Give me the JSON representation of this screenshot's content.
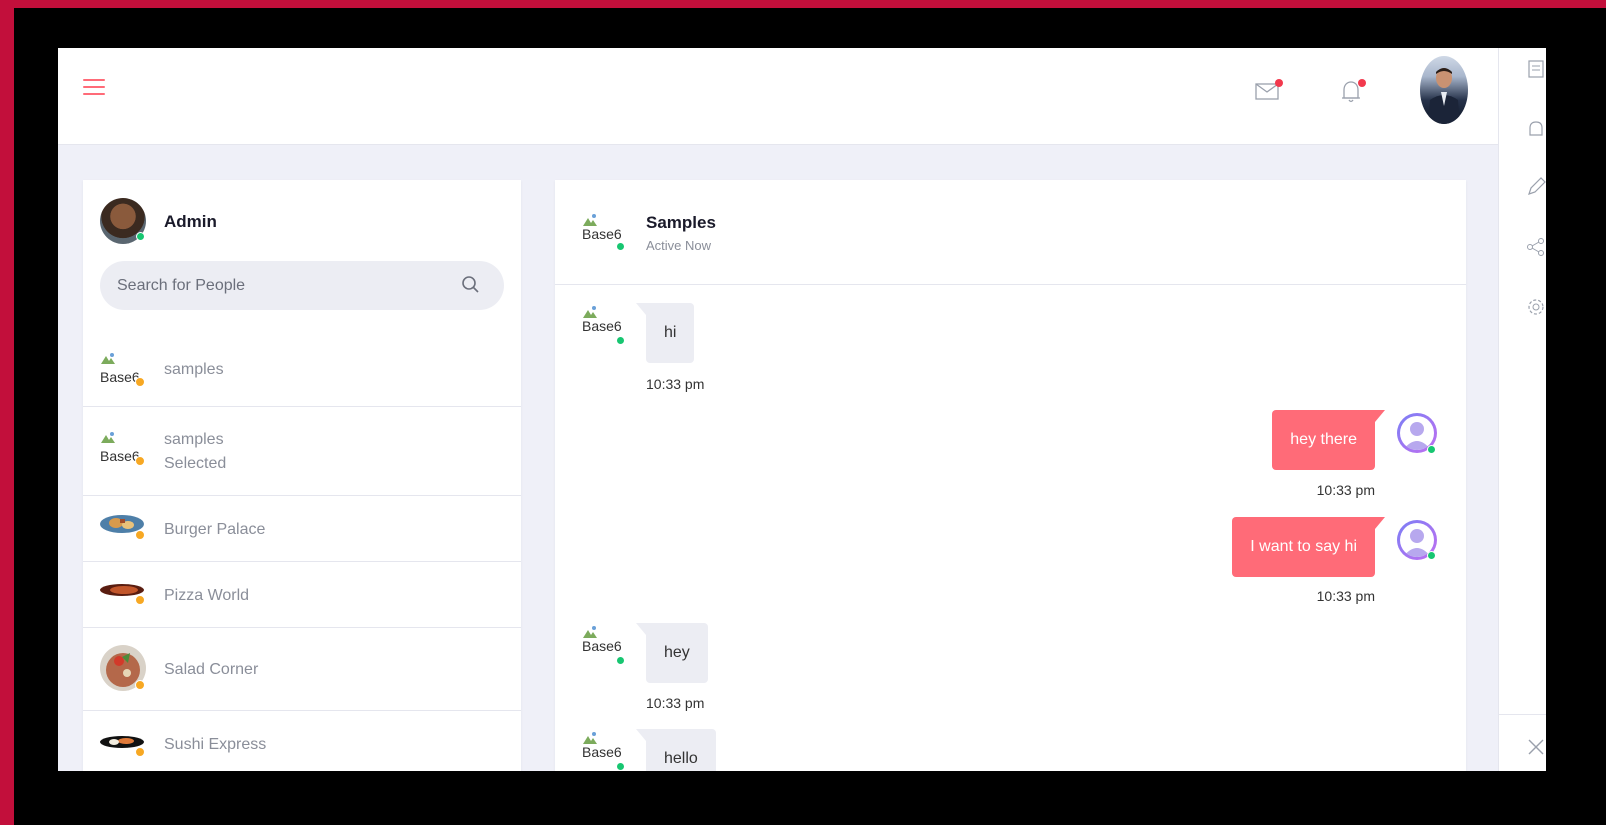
{
  "header": {
    "menu_icon": "hamburger-menu-icon",
    "mail_icon": "mail-icon",
    "bell_icon": "bell-icon"
  },
  "left": {
    "admin_name": "Admin",
    "search_placeholder": "Search for People",
    "contacts": [
      {
        "name": "samples",
        "sub": "",
        "img_alt": "Base6",
        "status": "away"
      },
      {
        "name": "samples",
        "sub": "Selected",
        "img_alt": "Base6",
        "status": "away"
      },
      {
        "name": "Burger Palace",
        "sub": "",
        "img_alt": "",
        "status": "away"
      },
      {
        "name": "Pizza World",
        "sub": "",
        "img_alt": "",
        "status": "away"
      },
      {
        "name": "Salad Corner",
        "sub": "",
        "img_alt": "",
        "status": "away"
      },
      {
        "name": "Sushi Express",
        "sub": "",
        "img_alt": "",
        "status": "away"
      }
    ]
  },
  "chat": {
    "title": "Samples",
    "status": "Active Now",
    "img_alt": "Base6",
    "messages": [
      {
        "dir": "in",
        "text": "hi",
        "time": "10:33 pm",
        "img_alt": "Base6"
      },
      {
        "dir": "out",
        "text": "hey there",
        "time": "10:33 pm"
      },
      {
        "dir": "out",
        "text": "I want to say hi",
        "time": "10:33 pm"
      },
      {
        "dir": "in",
        "text": "hey",
        "time": "10:33 pm",
        "img_alt": "Base6"
      },
      {
        "dir": "in",
        "text": "hello",
        "time": "",
        "img_alt": "Base6"
      }
    ]
  },
  "colors": {
    "accent": "#ff6b78",
    "online": "#17c671",
    "away": "#f7a823",
    "frame": "#c20f3b"
  }
}
